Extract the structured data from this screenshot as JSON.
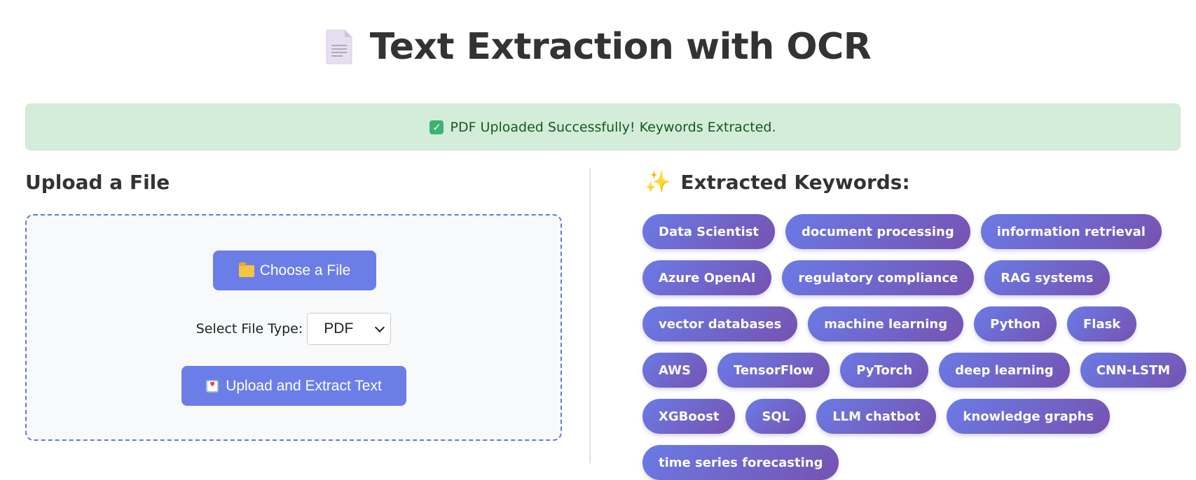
{
  "page": {
    "title": "Text Extraction with OCR",
    "title_icon": "document-icon"
  },
  "alert": {
    "icon": "checkmark-icon",
    "text": "PDF Uploaded Successfully! Keywords Extracted.",
    "colors": {
      "background": "#d4edda",
      "text": "#155724"
    }
  },
  "upload": {
    "heading": "Upload a File",
    "choose_button": {
      "label": "Choose a File",
      "icon": "folder-icon"
    },
    "file_type": {
      "label": "Select File Type:",
      "selected": "PDF"
    },
    "upload_button": {
      "label": "Upload and Extract Text",
      "icon": "inbox-tray-icon"
    }
  },
  "keywords": {
    "heading": "Extracted Keywords:",
    "icon": "sparkles-icon",
    "items": [
      "Data Scientist",
      "document processing",
      "information retrieval",
      "Azure OpenAI",
      "regulatory compliance",
      "RAG systems",
      "vector databases",
      "machine learning",
      "Python",
      "Flask",
      "AWS",
      "TensorFlow",
      "PyTorch",
      "deep learning",
      "CNN-LSTM",
      "XGBoost",
      "SQL",
      "LLM chatbot",
      "knowledge graphs",
      "time series forecasting"
    ]
  },
  "colors": {
    "accent": "#6b7ee8",
    "tag_gradient_start": "#6a7be6",
    "tag_gradient_end": "#7652b0"
  }
}
